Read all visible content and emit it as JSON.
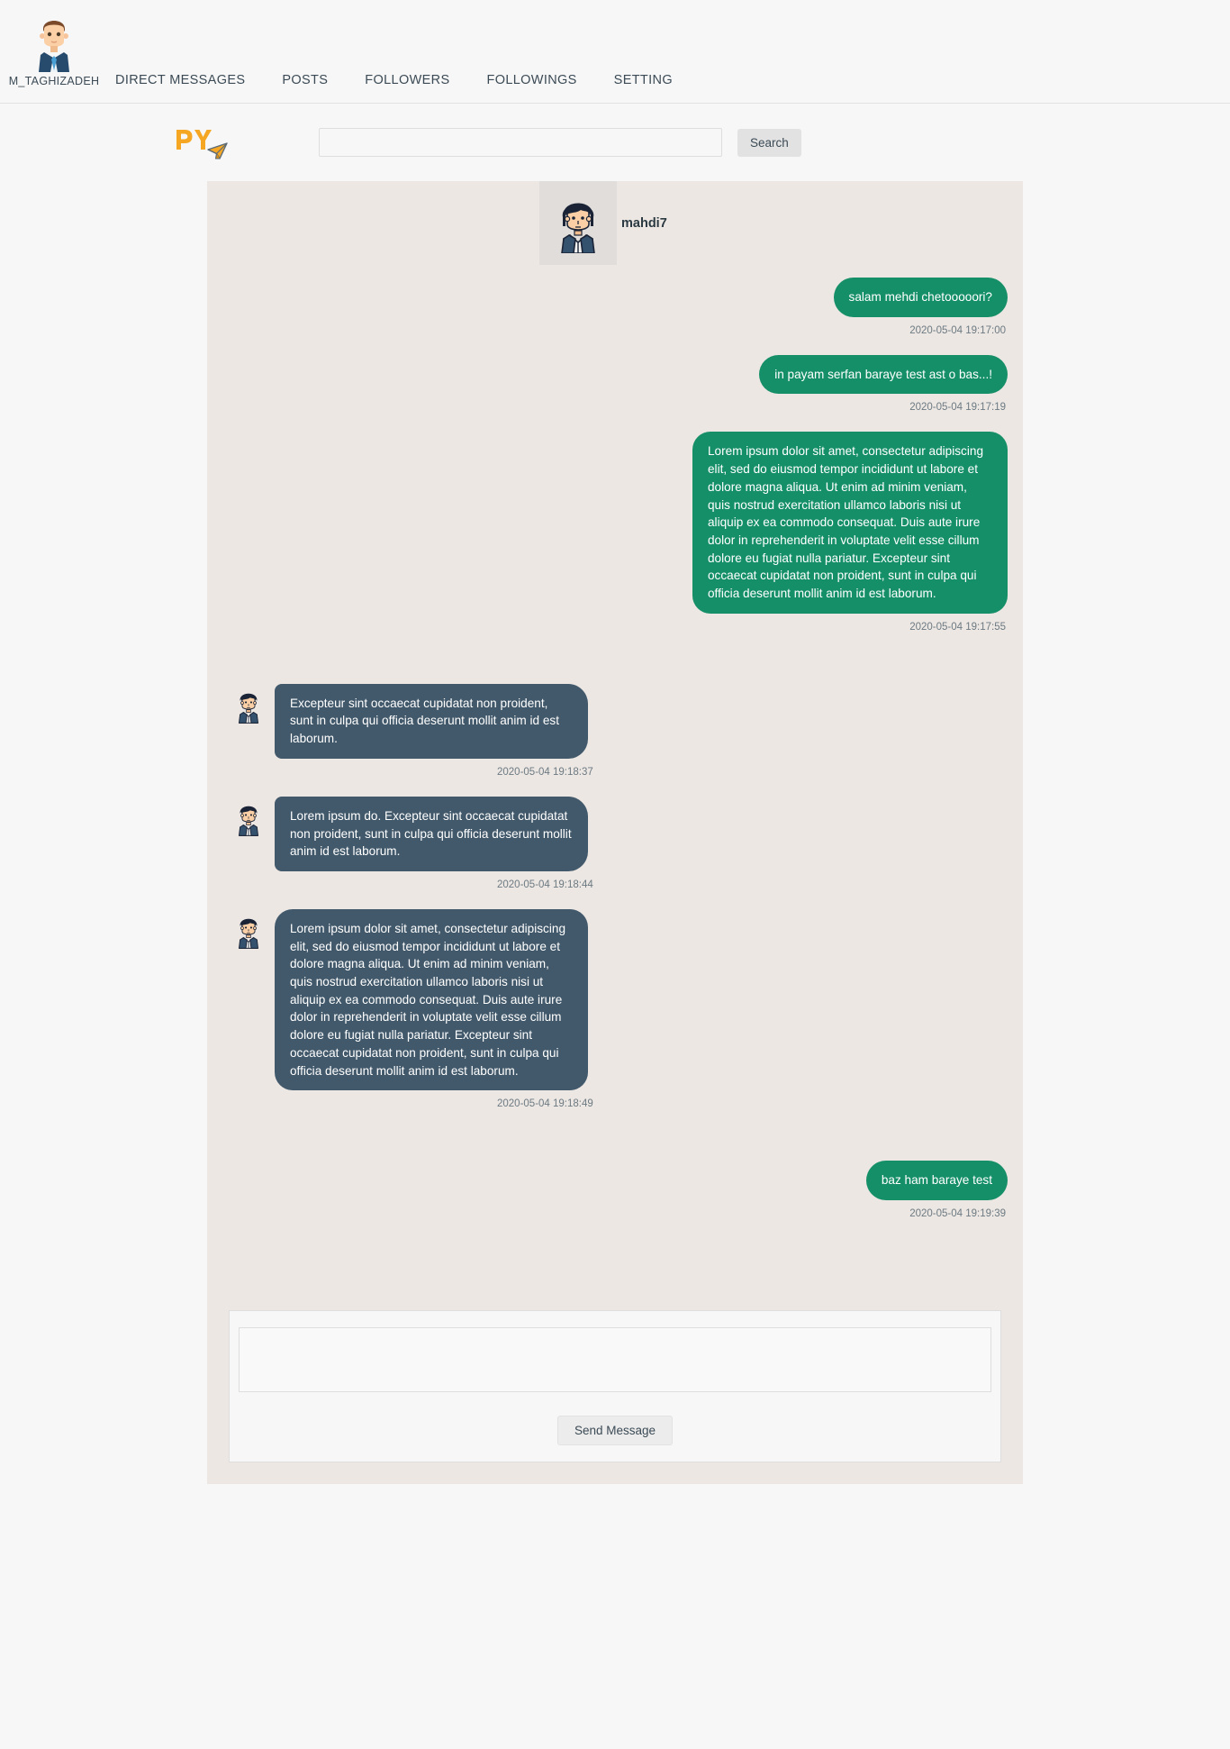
{
  "nav": {
    "username": "M_TAGHIZADEH",
    "avatar_icon": "user-avatar-icon",
    "links": [
      {
        "label": "DIRECT MESSAGES",
        "name": "nav-link-direct-messages"
      },
      {
        "label": "POSTS",
        "name": "nav-link-posts"
      },
      {
        "label": "FOLLOWERS",
        "name": "nav-link-followers"
      },
      {
        "label": "FOLLOWINGS",
        "name": "nav-link-followings"
      },
      {
        "label": "SETTING",
        "name": "nav-link-setting"
      }
    ]
  },
  "brand": {
    "text": "PY",
    "icon": "paper-plane-icon",
    "color": "#f5a623"
  },
  "search": {
    "value": "",
    "placeholder": "",
    "button_label": "Search"
  },
  "conversation": {
    "peer_name": "mahdi7",
    "peer_avatar_icon": "contact-avatar-icon",
    "colors": {
      "outgoing_bubble": "#158f68",
      "incoming_bubble": "#42596b",
      "panel_background": "#ece7e3",
      "timestamp": "#6d7a82"
    },
    "messages": [
      {
        "direction": "out",
        "text": "salam mehdi chetooooori?",
        "timestamp": "2020-05-04 19:17:00"
      },
      {
        "direction": "out",
        "text": "in payam serfan baraye test ast o bas...!",
        "timestamp": "2020-05-04 19:17:19"
      },
      {
        "direction": "out",
        "text": "Lorem ipsum dolor sit amet, consectetur adipiscing elit, sed do eiusmod tempor incididunt ut labore et dolore magna aliqua. Ut enim ad minim veniam, quis nostrud exercitation ullamco laboris nisi ut aliquip ex ea commodo consequat. Duis aute irure dolor in reprehenderit in voluptate velit esse cillum dolore eu fugiat nulla pariatur. Excepteur sint occaecat cupidatat non proident, sunt in culpa qui officia deserunt mollit anim id est laborum.",
        "timestamp": "2020-05-04 19:17:55"
      },
      {
        "direction": "in",
        "text": "Excepteur sint occaecat cupidatat non proident, sunt in culpa qui officia deserunt mollit anim id est laborum.",
        "timestamp": "2020-05-04 19:18:37"
      },
      {
        "direction": "in",
        "text": "Lorem ipsum do. Excepteur sint occaecat cupidatat non proident, sunt in culpa qui officia deserunt mollit anim id est laborum.",
        "timestamp": "2020-05-04 19:18:44"
      },
      {
        "direction": "in",
        "text": "Lorem ipsum dolor sit amet, consectetur adipiscing elit, sed do eiusmod tempor incididunt ut labore et dolore magna aliqua. Ut enim ad minim veniam, quis nostrud exercitation ullamco laboris nisi ut aliquip ex ea commodo consequat. Duis aute irure dolor in reprehenderit in voluptate velit esse cillum dolore eu fugiat nulla pariatur. Excepteur sint occaecat cupidatat non proident, sunt in culpa qui officia deserunt mollit anim id est laborum.",
        "timestamp": "2020-05-04 19:18:49"
      },
      {
        "direction": "out",
        "text": "baz ham baraye test",
        "timestamp": "2020-05-04 19:19:39"
      }
    ]
  },
  "composer": {
    "value": "",
    "placeholder": "",
    "send_label": "Send Message"
  }
}
